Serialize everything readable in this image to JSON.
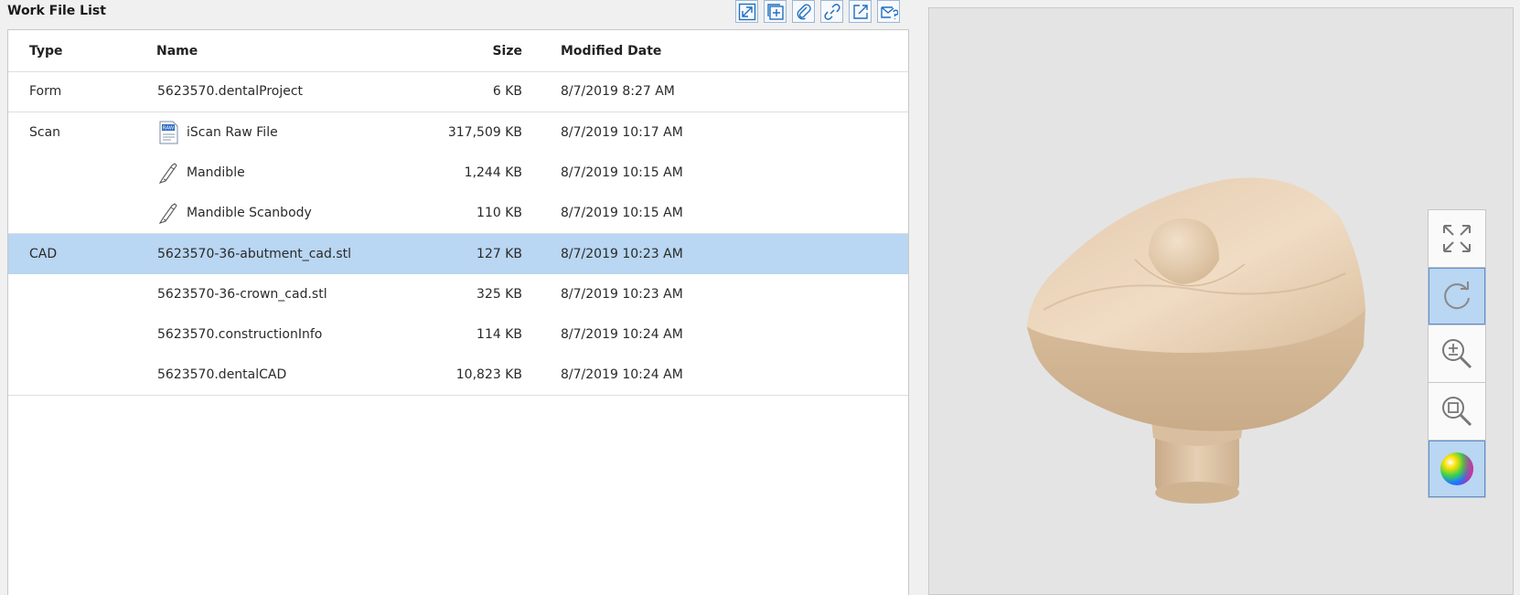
{
  "panel": {
    "title": "Work File List"
  },
  "toolbar": {
    "buttons": [
      {
        "icon": "expand-icon"
      },
      {
        "icon": "add-layer-icon"
      },
      {
        "icon": "attach-icon"
      },
      {
        "icon": "link-icon"
      },
      {
        "icon": "export-icon"
      },
      {
        "icon": "mail-icon"
      }
    ]
  },
  "table": {
    "headers": {
      "type": "Type",
      "name": "Name",
      "size": "Size",
      "date": "Modified Date"
    },
    "rows": [
      {
        "type": "Form",
        "name": "5623570.dentalProject",
        "size": "6 KB",
        "date": "8/7/2019 8:27 AM",
        "icon": ""
      },
      {
        "type": "Scan",
        "name": "iScan Raw File",
        "size": "317,509 KB",
        "date": "8/7/2019 10:17 AM",
        "icon": "raw-file-icon",
        "icon_label": "RAW"
      },
      {
        "type": "",
        "name": "Mandible",
        "size": "1,244 KB",
        "date": "8/7/2019 10:15 AM",
        "icon": "scanner-icon"
      },
      {
        "type": "",
        "name": "Mandible Scanbody",
        "size": "110 KB",
        "date": "8/7/2019 10:15 AM",
        "icon": "scanner-icon"
      },
      {
        "type": "CAD",
        "name": "5623570-36-abutment_cad.stl",
        "size": "127 KB",
        "date": "8/7/2019 10:23 AM",
        "icon": "",
        "selected": true
      },
      {
        "type": "",
        "name": "5623570-36-crown_cad.stl",
        "size": "325 KB",
        "date": "8/7/2019 10:23 AM",
        "icon": ""
      },
      {
        "type": "",
        "name": "5623570.constructionInfo",
        "size": "114 KB",
        "date": "8/7/2019 10:24 AM",
        "icon": ""
      },
      {
        "type": "",
        "name": "5623570.dentalCAD",
        "size": "10,823 KB",
        "date": "8/7/2019 10:24 AM",
        "icon": ""
      }
    ]
  },
  "viewer": {
    "tools": [
      {
        "icon": "fit-view-icon",
        "active": false
      },
      {
        "icon": "rotate-icon",
        "active": true
      },
      {
        "icon": "zoom-in-out-icon",
        "active": false
      },
      {
        "icon": "zoom-window-icon",
        "active": false
      },
      {
        "icon": "color-map-icon",
        "active": true
      }
    ]
  },
  "colors": {
    "accent": "#1f6fc0",
    "selection": "#b9d6f2",
    "model": "#ead4ba"
  }
}
